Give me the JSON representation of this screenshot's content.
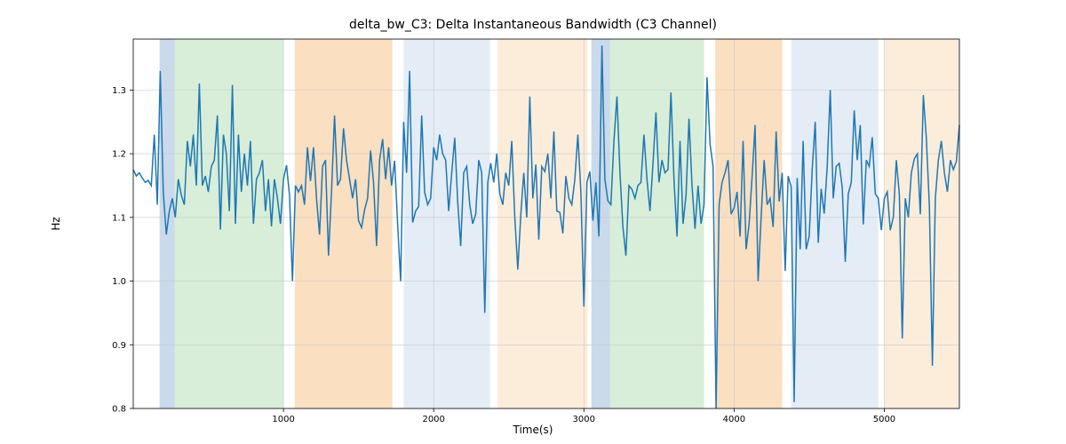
{
  "chart_data": {
    "type": "line",
    "title": "delta_bw_C3: Delta Instantaneous Bandwidth (C3 Channel)",
    "xlabel": "Time(s)",
    "ylabel": "Hz",
    "xlim": [
      0,
      5500
    ],
    "ylim": [
      0.8,
      1.38
    ],
    "x_ticks": [
      1000,
      2000,
      3000,
      4000,
      5000
    ],
    "y_ticks": [
      0.8,
      0.9,
      1.0,
      1.1,
      1.2,
      1.3
    ],
    "bands": [
      {
        "x0": 175,
        "x1": 275,
        "color": "#a6c2dd",
        "alpha": 0.6
      },
      {
        "x0": 275,
        "x1": 1000,
        "color": "#b8e0b8",
        "alpha": 0.55
      },
      {
        "x0": 1075,
        "x1": 1725,
        "color": "#f6c58e",
        "alpha": 0.55
      },
      {
        "x0": 1800,
        "x1": 2375,
        "color": "#d9e6f2",
        "alpha": 0.7
      },
      {
        "x0": 2425,
        "x1": 3025,
        "color": "#fbe5cc",
        "alpha": 0.7
      },
      {
        "x0": 3050,
        "x1": 3175,
        "color": "#a6c2dd",
        "alpha": 0.6
      },
      {
        "x0": 3175,
        "x1": 3800,
        "color": "#b8e0b8",
        "alpha": 0.55
      },
      {
        "x0": 3875,
        "x1": 4320,
        "color": "#f6c58e",
        "alpha": 0.55
      },
      {
        "x0": 4380,
        "x1": 4960,
        "color": "#d9e6f2",
        "alpha": 0.7
      },
      {
        "x0": 5000,
        "x1": 5500,
        "color": "#fbe5cc",
        "alpha": 0.7
      }
    ],
    "series": [
      {
        "name": "delta_bw_C3",
        "x_step": 20,
        "x_start": 0,
        "values": [
          1.175,
          1.165,
          1.17,
          1.162,
          1.155,
          1.158,
          1.15,
          1.23,
          1.12,
          1.33,
          1.14,
          1.073,
          1.11,
          1.13,
          1.1,
          1.16,
          1.135,
          1.12,
          1.22,
          1.18,
          1.23,
          1.15,
          1.31,
          1.15,
          1.165,
          1.14,
          1.18,
          1.19,
          1.26,
          1.081,
          1.23,
          1.2,
          1.11,
          1.308,
          1.09,
          1.23,
          1.14,
          1.2,
          1.15,
          1.22,
          1.09,
          1.16,
          1.17,
          1.19,
          1.11,
          1.16,
          1.086,
          1.16,
          1.13,
          1.09,
          1.16,
          1.182,
          1.135,
          1.0,
          1.15,
          1.14,
          1.15,
          1.12,
          1.21,
          1.157,
          1.21,
          1.13,
          1.073,
          1.18,
          1.19,
          1.04,
          1.14,
          1.26,
          1.15,
          1.16,
          1.24,
          1.19,
          1.16,
          1.13,
          1.16,
          1.095,
          1.084,
          1.112,
          1.13,
          1.205,
          1.155,
          1.055,
          1.19,
          1.223,
          1.16,
          1.21,
          1.15,
          1.189,
          1.09,
          1.0,
          1.25,
          1.17,
          1.33,
          1.092,
          1.11,
          1.117,
          1.26,
          1.14,
          1.12,
          1.13,
          1.21,
          1.19,
          1.23,
          1.2,
          1.19,
          1.11,
          1.17,
          1.225,
          1.125,
          1.055,
          1.17,
          1.18,
          1.12,
          1.09,
          1.105,
          1.19,
          1.17,
          0.95,
          1.155,
          1.185,
          1.155,
          1.2,
          1.137,
          1.12,
          1.17,
          1.15,
          1.22,
          1.1,
          1.018,
          1.105,
          1.17,
          1.1,
          1.29,
          1.13,
          1.183,
          1.065,
          1.18,
          1.172,
          1.2,
          1.13,
          1.235,
          1.11,
          1.108,
          1.075,
          1.165,
          1.13,
          1.12,
          1.16,
          1.23,
          1.14,
          0.96,
          1.155,
          1.172,
          1.095,
          1.155,
          1.07,
          1.37,
          1.16,
          1.126,
          1.12,
          1.22,
          1.29,
          1.17,
          1.085,
          1.04,
          1.15,
          1.144,
          1.13,
          1.15,
          1.155,
          1.23,
          1.16,
          1.11,
          1.185,
          1.265,
          1.155,
          1.19,
          1.17,
          1.175,
          1.296,
          1.16,
          1.07,
          1.22,
          1.09,
          1.135,
          1.255,
          1.15,
          1.082,
          1.15,
          1.09,
          1.12,
          1.32,
          1.215,
          1.18,
          0.8,
          1.12,
          1.155,
          1.17,
          1.19,
          1.105,
          1.115,
          1.14,
          1.07,
          1.22,
          1.05,
          1.09,
          1.165,
          1.245,
          1.0,
          1.1,
          1.19,
          1.12,
          1.13,
          1.085,
          1.235,
          1.125,
          1.17,
          1.016,
          1.165,
          1.148,
          0.81,
          1.162,
          1.05,
          1.22,
          1.05,
          1.07,
          1.175,
          1.25,
          1.06,
          1.145,
          1.106,
          1.18,
          1.3,
          1.13,
          1.18,
          1.185,
          1.147,
          1.03,
          1.137,
          1.155,
          1.268,
          1.19,
          1.245,
          1.089,
          1.19,
          1.18,
          1.226,
          1.137,
          1.13,
          1.08,
          1.13,
          1.14,
          1.08,
          1.1,
          1.19,
          1.136,
          0.91,
          1.13,
          1.1,
          1.17,
          1.192,
          1.2,
          1.105,
          1.292,
          1.224,
          1.118,
          0.867,
          1.13,
          1.19,
          1.22,
          1.17,
          1.14,
          1.19,
          1.175,
          1.188,
          1.245
        ]
      }
    ]
  }
}
